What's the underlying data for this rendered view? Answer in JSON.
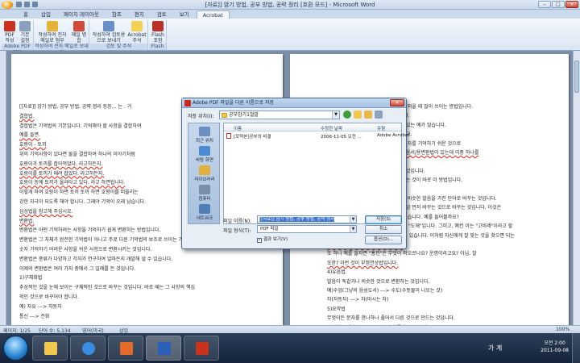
{
  "window": {
    "title": "[자료]] 암기 방법, 공부 방법, 공략 정리 [호환 모드] - Microsoft Word"
  },
  "ribbon": {
    "tabs": [
      "홈",
      "삽입",
      "페이지 레이아웃",
      "참조",
      "편지",
      "검토",
      "보기",
      "Acrobat"
    ],
    "active_tab": "Acrobat",
    "groups": [
      {
        "label": "Adobe PDF 작성",
        "buttons": [
          "PDF 작성",
          "기본 설정"
        ]
      },
      {
        "label": "작성하여 전자 메일로 보내기",
        "buttons": [
          "작성하여 전자 메일로 첨부",
          "메일 병합"
        ]
      },
      {
        "label": "검토 및 주석",
        "buttons": [
          "작성하여 검토용으로 보내기",
          "Acrobat 주석"
        ]
      },
      {
        "label": "Flash",
        "buttons": [
          "Flash 포함"
        ]
      }
    ]
  },
  "document": {
    "left_page": [
      {
        "text": "[[자료]] 암기 방법, 공부 방법, 공략 정리 등등... 는 . 거",
        "red": false
      },
      {
        "text": "결합법.",
        "red": true
      },
      {
        "text": "결합법은 기억법의 기본입니다. 기억해야 할 사항을 결합하여",
        "red": false
      },
      {
        "text": "예를 들면.",
        "red": true
      },
      {
        "text": "호랑이 - 토끼",
        "red": true
      },
      {
        "text": "위의 기억사항이 있다면 둘을 결합하여 하나의 이야기처럼",
        "red": false
      },
      {
        "text": "호랑이가 토끼를 잡아먹었다. 라고하든지.",
        "red": true
      },
      {
        "text": "호랑이를 토끼가 때려 잡았다. 라고하든지.",
        "red": true
      },
      {
        "text": "호랑이 등에 토끼가 올라타고 있다. 라고 하면됩니다.",
        "red": true
      },
      {
        "text": "이렇게 하여 호랑이 하면 토끼 토끼 하면 호랑이를 떠올리는",
        "red": false
      },
      {
        "text": "강한 자극이 되도록 해야 합니다. 그래야 기억이 오래 남습니다.",
        "red": false
      },
      {
        "text": "심상법을 참고해 주십시오.",
        "red": true
      },
      {
        "text": "변환법.",
        "red": true
      },
      {
        "text": "변환법은 어떤 기억하려는 사항을 기억하기 쉽게 변환하는 방법입니다.",
        "red": false
      },
      {
        "text": "변환법은 그 자체가 완전한 기억법이 아니고 주로 다른 기억법의 보조로 쓰이는 기억법으로",
        "red": false
      },
      {
        "text": "숫자 기억하기 어려운 사항을 쉬운 사항으로 변환시키는 것입니다.",
        "red": false
      },
      {
        "text": "변환법은 종류가 다양하고 각자가 연구하여 얼마든지 개발해 낼 수 있습니다.",
        "red": false
      },
      {
        "text": "이제의 변환법은 여러 가지 중에서 그 일례를 든 것입니다.",
        "red": false
      },
      {
        "text": "1)구체화법",
        "red": false
      },
      {
        "text": "추상적인 것을 눈에 보이는 구체적인 것으로 바꾸는 것입니다. 바로 떼는 그 사항의 핵심",
        "red": false
      },
      {
        "text": "적인 것으로 바꾸어야 합니다.",
        "red": false
      },
      {
        "text": "예) 자유 ---> 자동차",
        "red": false
      },
      {
        "text": "통신 ---> 전화",
        "red": false
      }
    ],
    "right_page": [
      {
        "text": "간단해 보이는 것도 있습니다. 영어단어 외울 때 많이 쓰이는 방법입니다.",
        "red": false
      },
      {
        "text": "(기억하기 쉬운 단어로 바꾸는) 것입니다.",
        "red": false
      },
      {
        "text": "어려운 것이 있다면. 주변에 흔히 볼 수 있는 예가 많습니다.",
        "red": false
      },
      {
        "text": "연결한 것으로 기억하는 것은 아니 입니다.",
        "red": false
      },
      {
        "text": "바꾸는 것은 뿐만이 아닙니다. 그래서 숫자를 기억하기 쉬운 것으로",
        "red": false
      },
      {
        "text": "사용이 있는데. 유명한 일대일변환법과 음서/용변환법이 있는데 이중 하나를",
        "red": true
      },
      {
        "text": "바꾸는 것입니다.",
        "red": false
      },
      {
        "text": "이런 기억하기 쉬운 사항으로 변환하는 것입니다.",
        "red": false
      },
      {
        "text": "것을 떠올리기 쉬운 말로 바꾸어 기억하는 것이 바로 이 방법입니다.",
        "red": false
      },
      {
        "text": "3)변음법(불러있는 것)",
        "red": false
      },
      {
        "text": "어떤 발음하기 어려운 단어를 하면 그와 비슷한 발음을 가진 단어로 바꾸는 것입니다.",
        "red": false
      },
      {
        "text": "자의 하나는 변음법은 개념이 틀리게 조금 먼저 바꾸는 것으로 바꾸는 것입니다. 이것은",
        "red": false
      },
      {
        "text": "든 주관적인 언어유희 인지하고 알 수 있습니다. 예를 들어볼까요?",
        "red": false
      },
      {
        "text": "\"빈칸\"이란 뜻이 떠오릅니까? 예컨 이는 \"도깨\"입니다. 그러고, 예컨 이는 \"고비레\"이라고 할",
        "red": false
      },
      {
        "text": "것이고 또 어떤 이는 \"정크\"이라고 할 수 있습니다. 이처럼 자신에게 잘 맞는 것을 찾으면 되는",
        "red": false
      },
      {
        "text": "것으로 바꾸는 것이 부정연상법입니다.",
        "red": true
      },
      {
        "text": "또 하나 예를 들자면 \"홍천\"은 무엇이 떠오르나요? 운명이라고요? 아닙, 잘",
        "red": false
      },
      {
        "text": "또한? 이런 것이 부정연상법입니다.",
        "red": true
      },
      {
        "text": "4)유음법.",
        "red": false
      },
      {
        "text": "발음이 똑같거나 비슷한 것으로 변환하는 것입니다.",
        "red": false
      },
      {
        "text": "예)수업(그냥의 음성도서) ---> 수도(수돗물이 나오는 것)",
        "red": false
      },
      {
        "text": "차(자동차) ---> 차(마시는 차)",
        "red": false
      },
      {
        "text": "5)요약법",
        "red": false
      },
      {
        "text": "무엇이든 문자를 한나하나 풀어서 다른 것으로 만드는 것입니다.",
        "red": false
      },
      {
        "text": "범저(불교인 한 종류) ---> 범비가 좋지 제사 깃거",
        "red": false
      }
    ]
  },
  "dialog": {
    "title": "Adobe PDF 파일을 다른 이름으로 저장",
    "look_in_label": "저장 위치(I):",
    "look_in_value": "공부암기1절말",
    "places": [
      "최근 위치",
      "바탕 화면",
      "라이브러리",
      "컴퓨터",
      "네트워크"
    ],
    "columns": [
      "이름",
      "수정한 날짜",
      "유형"
    ],
    "files": [
      {
        "name": "[모약본]공부의 비결",
        "date": "2006-11-05 오전 ...",
        "type": "Adobe Acrobat"
      }
    ],
    "filename_label": "파일 이름(N):",
    "filename_value": "[[자료]] 암기 방법, 공부 방법, 공략 정리",
    "filetype_label": "파일 형식(T):",
    "filetype_value": "PDF 파일",
    "checkbox_label": "결과 보기(V)",
    "checkbox_checked": true,
    "buttons": {
      "save": "저장(S)",
      "cancel": "취소",
      "options": "옵션(O)..."
    }
  },
  "statusbar": {
    "page": "페이지: 1/25",
    "words": "단어 수: 5,134",
    "lang": "영어(미국)",
    "mode": "삽입",
    "zoom": "100%"
  },
  "taskbar": {
    "ime": "가 계",
    "time": "오전 2:00",
    "date": "2011-09-08"
  }
}
